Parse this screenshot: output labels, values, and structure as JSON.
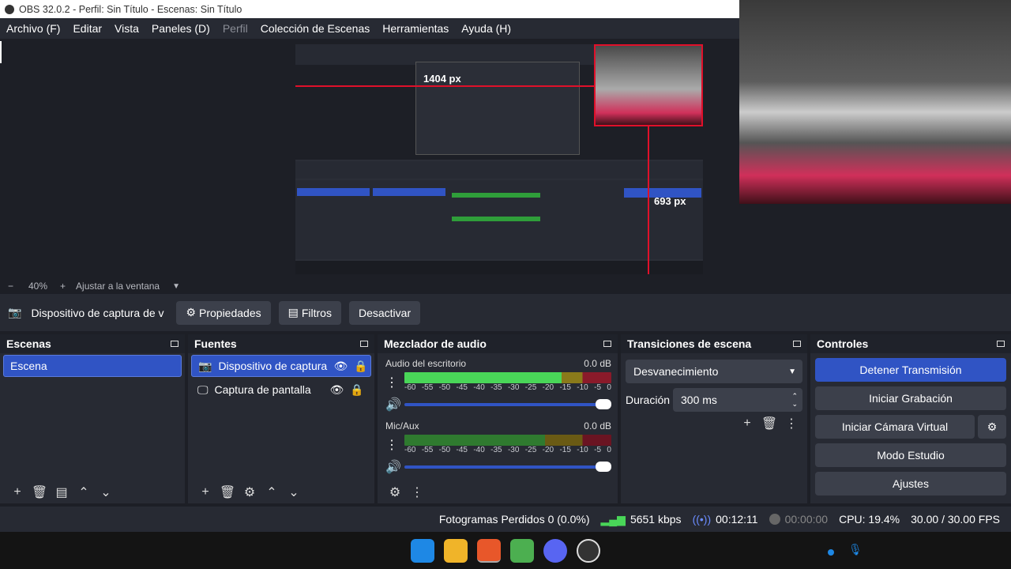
{
  "window": {
    "title": "OBS 32.0.2 - Perfil: Sin Título - Escenas: Sin Título"
  },
  "menu": [
    "Archivo (F)",
    "Editar",
    "Vista",
    "Paneles (D)",
    "Perfil",
    "Colección de Escenas",
    "Herramientas",
    "Ayuda (H)"
  ],
  "preview": {
    "dim_horizontal": "1404 px",
    "dim_vertical": "693 px"
  },
  "zoom": {
    "minus": "−",
    "level": "40%",
    "plus": "+",
    "fit_label": "Ajustar a la ventana"
  },
  "source_bar": {
    "source_name": "Dispositivo de captura de v",
    "properties": "Propiedades",
    "filters": "Filtros",
    "deactivate": "Desactivar"
  },
  "scenes": {
    "title": "Escenas",
    "items": [
      "Escena"
    ]
  },
  "sources": {
    "title": "Fuentes",
    "items": [
      "Dispositivo de captura d",
      "Captura de pantalla"
    ]
  },
  "mixer": {
    "title": "Mezclador de audio",
    "channels": [
      {
        "name": "Audio del escritorio",
        "db": "0.0 dB"
      },
      {
        "name": "Mic/Aux",
        "db": "0.0 dB"
      }
    ],
    "scale": [
      "-60",
      "-55",
      "-50",
      "-45",
      "-40",
      "-35",
      "-30",
      "-25",
      "-20",
      "-15",
      "-10",
      "-5",
      "0"
    ]
  },
  "transitions": {
    "title": "Transiciones de escena",
    "selected": "Desvanecimiento",
    "duration_label": "Duración",
    "duration_value": "300 ms"
  },
  "controls": {
    "title": "Controles",
    "stop_stream": "Detener Transmisión",
    "start_record": "Iniciar Grabación",
    "virtual_cam": "Iniciar Cámara Virtual",
    "studio_mode": "Modo Estudio",
    "settings": "Ajustes"
  },
  "status": {
    "dropped_frames": "Fotogramas Perdidos 0 (0.0%)",
    "bitrate": "5651 kbps",
    "stream_time": "00:12:11",
    "record_time": "00:00:00",
    "cpu": "CPU: 19.4%",
    "fps": "30.00 / 30.00 FPS"
  },
  "colors": {
    "accent": "#3054c4",
    "panel": "#272a33",
    "background": "#1d1f26"
  }
}
